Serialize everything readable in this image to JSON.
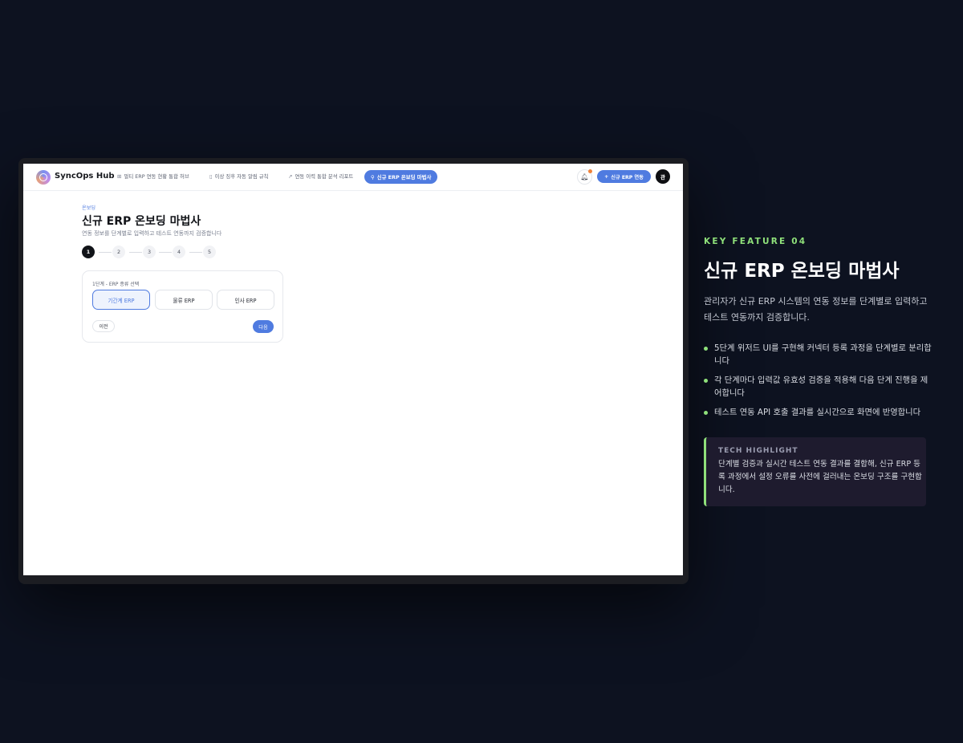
{
  "app": {
    "logo_text": "SyncOps Hub",
    "nav": [
      {
        "icon": "grid-icon",
        "label": "멀티 ERP 연동 현황 통합 허브"
      },
      {
        "icon": "bookmark-icon",
        "label": "이상 징후 자동 알림 규칙"
      },
      {
        "icon": "trend-icon",
        "label": "연동 이력 통합 분석 리포트"
      }
    ],
    "nav_active": {
      "icon": "search-icon",
      "label": "신규 ERP 온보딩 마법사"
    },
    "cta_label": "신규 ERP 연동",
    "avatar_text": "관"
  },
  "page": {
    "breadcrumb": "온보딩",
    "title": "신규 ERP 온보딩 마법사",
    "subtitle": "연동 정보를 단계별로 입력하고 테스트 연동까지 검증합니다",
    "steps": [
      "1",
      "2",
      "3",
      "4",
      "5"
    ],
    "active_step": 1,
    "card": {
      "label": "1단계 - ERP 종류 선택",
      "options": [
        "기간계 ERP",
        "물류 ERP",
        "인사 ERP"
      ],
      "selected_option": "기간계 ERP",
      "prev_label": "이전",
      "next_label": "다음"
    }
  },
  "feature": {
    "kicker": "KEY FEATURE 04",
    "title": "신규 ERP 온보딩 마법사",
    "description": "관리자가 신규 ERP 시스템의 연동 정보를 단계별로 입력하고 테스트 연동까지 검증합니다.",
    "bullets": [
      "5단계 위저드 UI를 구현해 커넥터 등록 과정을 단계별로 분리합니다",
      "각 단계마다 입력값 유효성 검증을 적용해 다음 단계 진행을 제어합니다",
      "테스트 연동 API 호출 결과를 실시간으로 화면에 반영합니다"
    ],
    "tech_label": "TECH HIGHLIGHT",
    "tech_body": "단계별 검증과 실시간 테스트 연동 결과를 결합해, 신규 ERP 등록 과정에서 설정 오류를 사전에 걸러내는 온보딩 구조를 구현합니다."
  },
  "colors": {
    "accent": "#4f7be0",
    "highlight_green": "#8fe07a",
    "background": "#0d1220"
  }
}
